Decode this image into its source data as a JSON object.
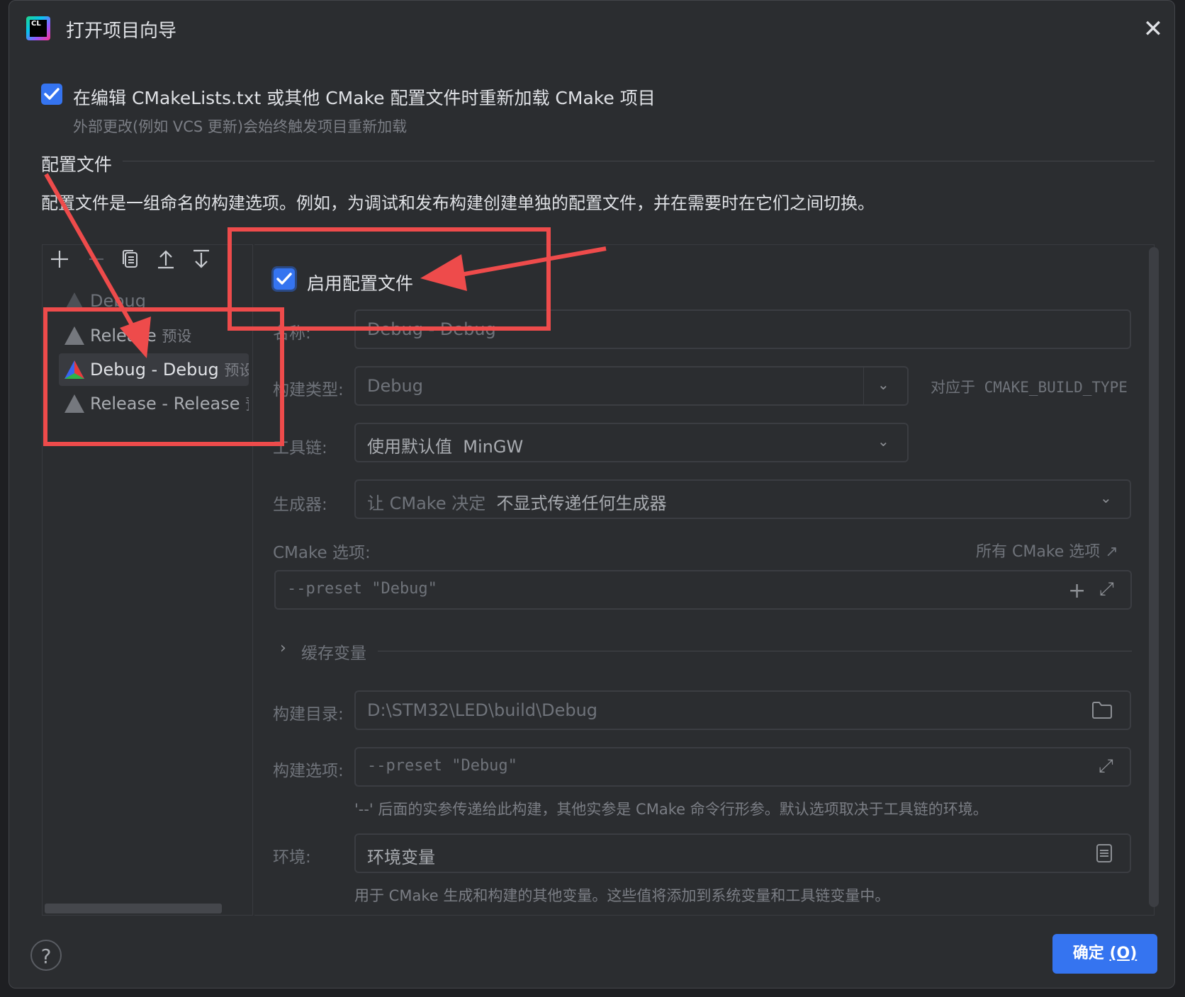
{
  "window": {
    "title": "打开项目向导",
    "logo_text": "CL"
  },
  "reload": {
    "checked": true,
    "label": "在编辑 CMakeLists.txt 或其他 CMake 配置文件时重新加载 CMake 项目",
    "hint": "外部更改(例如 VCS 更新)会始终触发项目重新加载"
  },
  "profiles": {
    "section_title": "配置文件",
    "description": "配置文件是一组命名的构建选项。例如，为调试和发布构建创建单独的配置文件，并在需要时在它们之间切换。",
    "toolbar_icons": [
      "add-icon",
      "remove-icon",
      "copy-icon",
      "move-up-icon",
      "move-down-icon"
    ],
    "list": [
      {
        "name": "Debug",
        "suffix": "",
        "selected": false,
        "colored": false
      },
      {
        "name": "Release",
        "suffix": "预设",
        "selected": false,
        "colored": false
      },
      {
        "name": "Debug - Debug",
        "suffix": "预设",
        "selected": true,
        "colored": true
      },
      {
        "name": "Release - Release",
        "suffix": "预",
        "selected": false,
        "colored": false
      }
    ]
  },
  "form": {
    "enable_label": "启用配置文件",
    "enable_checked": true,
    "name_label": "名称:",
    "name_value": "Debug - Debug",
    "build_type_label": "构建类型:",
    "build_type_value": "Debug",
    "build_type_hint": "对应于 CMAKE_BUILD_TYPE",
    "toolchain_label": "工具链:",
    "toolchain_value": "使用默认值",
    "toolchain_detail": "MinGW",
    "generator_label": "生成器:",
    "generator_value": "让 CMake 决定",
    "generator_detail": "不显式传递任何生成器",
    "cmake_options_label": "CMake 选项:",
    "all_cmake_options_link": "所有 CMake 选项",
    "cmake_options_value": "--preset \"Debug\"",
    "cache_vars_label": "缓存变量",
    "build_dir_label": "构建目录:",
    "build_dir_value": "D:\\STM32\\LED\\build\\Debug",
    "build_options_label": "构建选项:",
    "build_options_value": "--preset \"Debug\"",
    "build_options_hint": "'--' 后面的实参传递给此构建，其他实参是 CMake 命令行形参。默认选项取决于工具链的环境。",
    "env_label": "环境:",
    "env_value": "环境变量",
    "env_hint": "用于 CMake 生成和构建的其他变量。这些值将添加到系统变量和工具链变量中。"
  },
  "footer": {
    "help": "?",
    "ok_label": "确定",
    "ok_mnemonic": "(O)"
  },
  "colors": {
    "accent": "#3574f0",
    "annotation": "#ee4b4b",
    "background": "#2b2d30"
  }
}
